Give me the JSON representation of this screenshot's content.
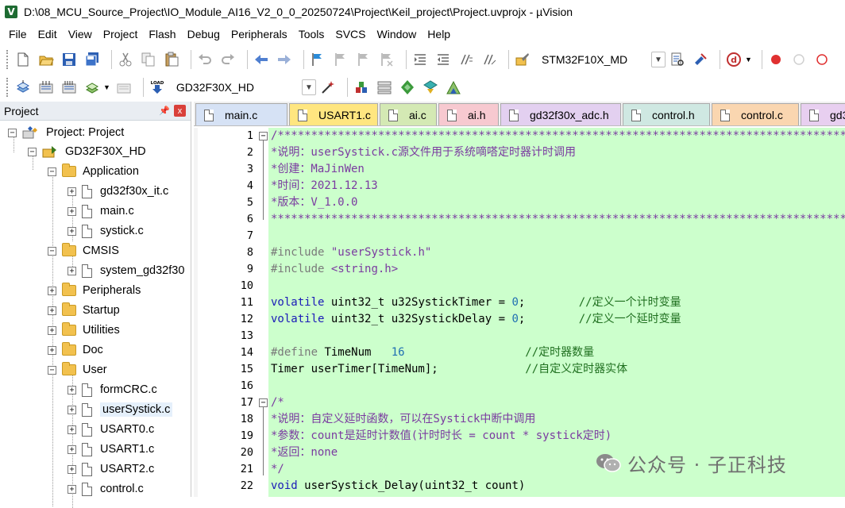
{
  "window": {
    "title": "D:\\08_MCU_Source_Project\\IO_Module_AI16_V2_0_0_20250724\\Project\\Keil_project\\Project.uvprojx - µVision",
    "icon_letter": "V"
  },
  "menu": [
    "File",
    "Edit",
    "View",
    "Project",
    "Flash",
    "Debug",
    "Peripherals",
    "Tools",
    "SVCS",
    "Window",
    "Help"
  ],
  "toolbar": {
    "target_device": "STM32F10X_MD",
    "build_target": "GD32F30X_HD",
    "load_label": "LOAD",
    "colors": {
      "red_dot": "#e03030",
      "gray_dot": "#d0d0d0"
    }
  },
  "project_panel": {
    "title": "Project",
    "pin": "ᵖ",
    "close": "x",
    "tree": {
      "root": "Project: Project",
      "target": "GD32F30X_HD",
      "groups": {
        "application": "Application",
        "application_files": [
          "gd32f30x_it.c",
          "main.c",
          "systick.c"
        ],
        "cmsis": "CMSIS",
        "cmsis_files": [
          "system_gd32f30"
        ],
        "peripherals": "Peripherals",
        "startup": "Startup",
        "utilities": "Utilities",
        "doc": "Doc",
        "user": "User",
        "user_files": [
          "formCRC.c",
          "userSystick.c",
          "USART0.c",
          "USART1.c",
          "USART2.c",
          "control.c"
        ]
      }
    }
  },
  "tabs": [
    {
      "label": "main.c",
      "color": "#d6e2f5"
    },
    {
      "label": "USART1.c",
      "color": "#ffe680"
    },
    {
      "label": "ai.c",
      "color": "#d4e9b4"
    },
    {
      "label": "ai.h",
      "color": "#f7c9d0"
    },
    {
      "label": "gd32f30x_adc.h",
      "color": "#e3d0f0"
    },
    {
      "label": "control.h",
      "color": "#cfe8e2"
    },
    {
      "label": "control.c",
      "color": "#fad6b0"
    },
    {
      "label": "gd3",
      "color": "#e8cff0"
    }
  ],
  "editor": {
    "line_numbers": [
      "1",
      "2",
      "3",
      "4",
      "5",
      "6",
      "7",
      "8",
      "9",
      "10",
      "11",
      "12",
      "13",
      "14",
      "15",
      "16",
      "17",
      "18",
      "19",
      "20",
      "21",
      "22"
    ],
    "fold_markers": {
      "l1": "−",
      "l17": "−"
    },
    "lines": {
      "l1": "/**********************************************************************************************",
      "l2": "*说明：userSystick.c源文件用于系统嘀嗒定时器计时调用",
      "l3": "*创建：MaJinWen",
      "l4": "*时间：2021.12.13",
      "l5": "*版本：V_1.0.0",
      "l6": "***********************************************************************************************",
      "l7": "",
      "l8_kw": "#include",
      "l8_str": " \"userSystick.h\"",
      "l9_kw": "#include",
      "l9_str": " <string.h>",
      "l10": "",
      "l11_kw": "volatile",
      "l11_code": " uint32_t u32SystickTimer = ",
      "l11_num": "0",
      "l11_end": ";",
      "l11_cmt": "        //定义一个计时变量",
      "l12_kw": "volatile",
      "l12_code": " uint32_t u32SystickDelay = ",
      "l12_num": "0",
      "l12_end": ";",
      "l12_cmt": "        //定义一个延时变量",
      "l13": "",
      "l14_kw": "#define",
      "l14_code": " TimeNum   ",
      "l14_num": "16",
      "l14_cmt": "                  //定时器数量",
      "l15_code": "Timer userTimer[TimeNum];",
      "l15_cmt": "             //自定义定时器实体",
      "l16": "",
      "l17": "/*",
      "l18": "*说明：自定义延时函数，可以在Systick中断中调用",
      "l19": "*参数：count是延时计数值(计时时长 = count * systick定时)",
      "l20": "*返回：none",
      "l21": "*/",
      "l22_kw": "void",
      "l22_code": " userSystick_Delay(uint32_t count)"
    }
  },
  "watermark": "公众号 · 子正科技"
}
